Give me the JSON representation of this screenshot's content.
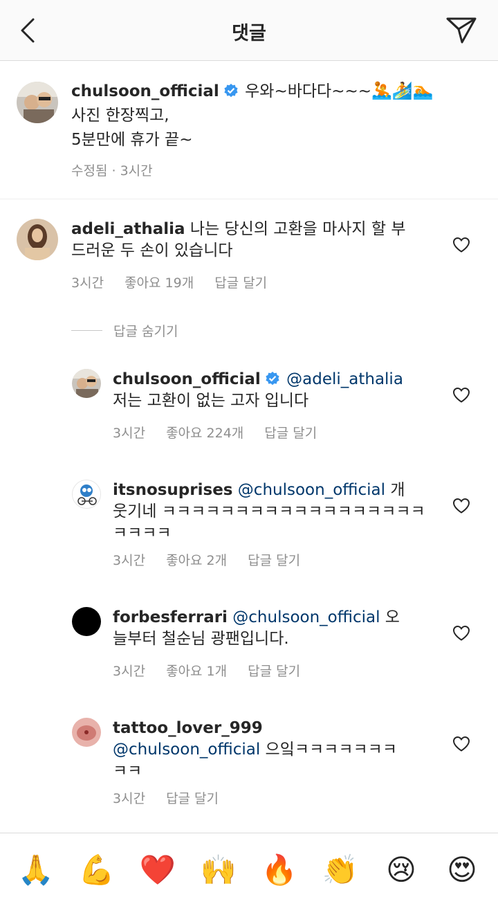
{
  "header": {
    "title": "댓글",
    "back_icon": "chevron-left-icon",
    "send_icon": "direct-send-icon"
  },
  "caption": {
    "username": "chulsoon_official",
    "verified": true,
    "line1": "우와~바다다~~~",
    "emojis": "🤽🏄🏊",
    "line2": "사진 한장찍고,",
    "line3": "5분만에 휴가 끝~",
    "edited": "수정됨",
    "separator": " · ",
    "time": "3시간"
  },
  "comments": [
    {
      "username": "adeli_athalia",
      "text_line1": "나는 당신의 고환을 마사지 할 부",
      "text_line2": "드러운 두 손이 있습니다",
      "time": "3시간",
      "likes": "좋아요 19개",
      "reply": "답글 달기"
    }
  ],
  "hide_replies": "답글 숨기기",
  "replies": [
    {
      "username": "chulsoon_official",
      "verified": true,
      "mention": "@adeli_athalia",
      "text_line1": "저는 고환이 없는 고자 입니다",
      "time": "3시간",
      "likes": "좋아요 224개",
      "reply": "답글 달기"
    },
    {
      "username": "itsnosuprises",
      "mention": "@chulsoon_official",
      "text_after_mention": " 개",
      "text_line2": "웃기네 ㅋㅋㅋㅋㅋㅋㅋㅋㅋㅋㅋㅋㅋㅋㅋㅋㅋㅋ",
      "text_line3": "ㅋㅋㅋㅋ",
      "time": "3시간",
      "likes": "좋아요 2개",
      "reply": "답글 달기"
    },
    {
      "username": "forbesferrari",
      "mention": "@chulsoon_official",
      "text_after_mention": " 오",
      "text_line2": "늘부터 철순님 광팬입니다.",
      "time": "3시간",
      "likes": "좋아요 1개",
      "reply": "답글 달기"
    },
    {
      "username": "tattoo_lover_999",
      "mention": "@chulsoon_official",
      "text_after_mention": " 으잌ㅋㅋㅋㅋㅋㅋㅋ",
      "text_line3": "ㅋㅋ",
      "time": "3시간",
      "reply": "답글 달기"
    }
  ],
  "emoji_bar": [
    "🙏",
    "💪",
    "❤️",
    "🙌",
    "🔥",
    "👏",
    "😢",
    "😍"
  ],
  "colors": {
    "link": "#00376b",
    "meta": "#8e8e8e",
    "text": "#262626",
    "verified": "#3897f0"
  }
}
